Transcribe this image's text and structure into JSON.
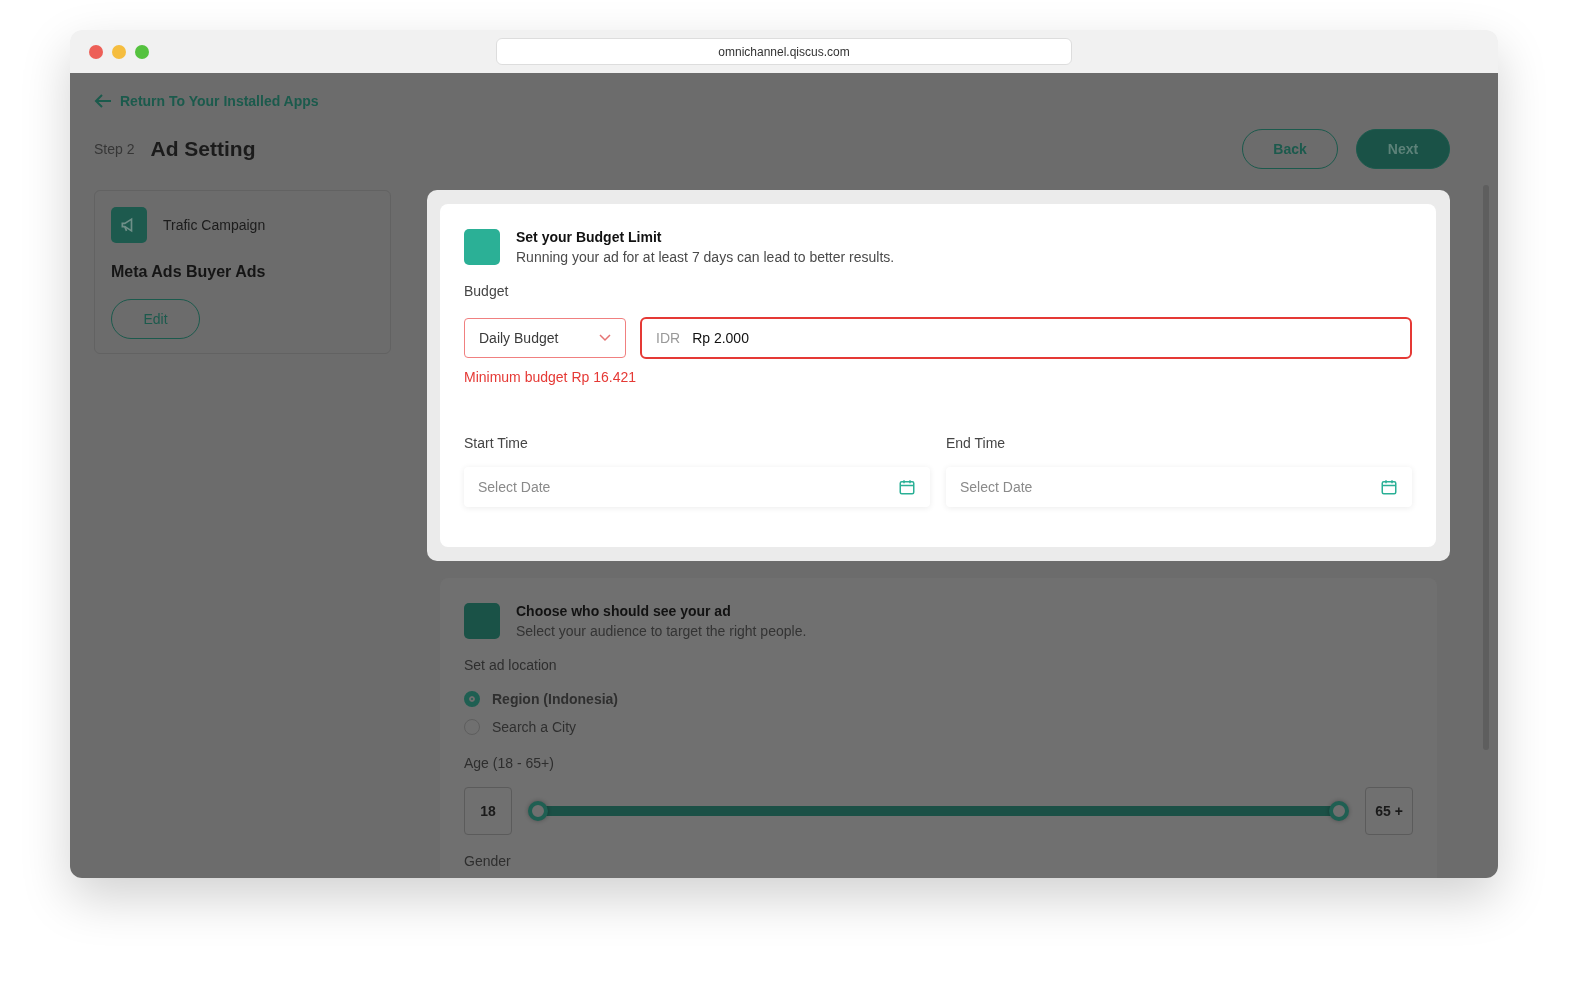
{
  "browser": {
    "url": "omnichannel.qiscus.com"
  },
  "back_link": "Return To Your Installed Apps",
  "header": {
    "step": "Step 2",
    "title": "Ad Setting"
  },
  "header_buttons": [
    {
      "label": "Back",
      "kind": "outline"
    },
    {
      "label": "Next",
      "kind": "solid"
    }
  ],
  "campaign_card": {
    "type": "Trafic Campaign",
    "name": "Meta Ads Buyer Ads",
    "edit_button": "Edit"
  },
  "budget_section": {
    "title": "Set your Budget Limit",
    "subtitle": "Running your ad for at least 7 days can lead to better results.",
    "budget_label": "Budget",
    "budget_type": "Daily Budget",
    "currency": "IDR",
    "amount": "Rp 2.000",
    "error": "Minimum budget Rp 16.421",
    "dates": [
      {
        "label": "Start Time",
        "placeholder": "Select Date"
      },
      {
        "label": "End Time",
        "placeholder": "Select Date"
      }
    ]
  },
  "audience_section": {
    "title": "Choose who should see your ad",
    "subtitle": "Select your audience to target the right people.",
    "location_label": "Set ad location",
    "location_options": [
      {
        "label": "Region (Indonesia)",
        "selected": true
      },
      {
        "label": "Search a City",
        "selected": false
      }
    ],
    "age_label": "Age (18 - 65+)",
    "age_min": "18",
    "age_max": "65 +",
    "age_thumbs": [
      {
        "level": 0
      },
      {
        "level": 1
      }
    ],
    "gender_label": "Gender"
  }
}
